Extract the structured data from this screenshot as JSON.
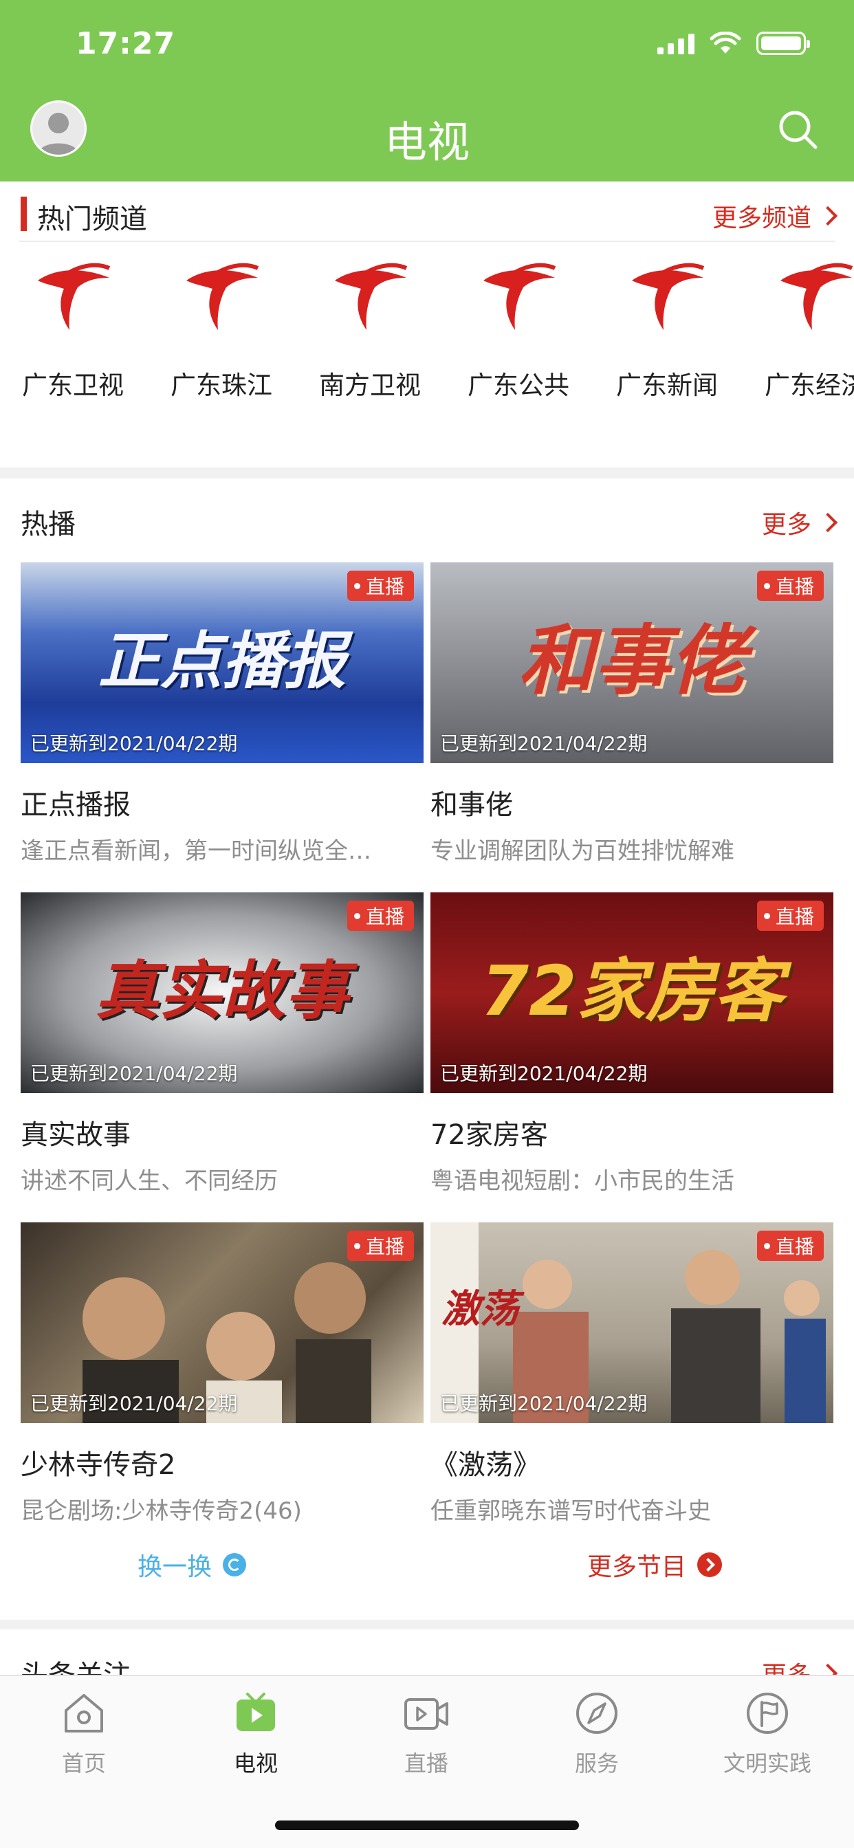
{
  "status_bar": {
    "time": "17:27"
  },
  "header": {
    "title": "电视"
  },
  "colors": {
    "brand_green": "#7ec953",
    "accent_red": "#d42d20",
    "live_red": "#e23b30",
    "refresh_blue": "#4ab1e6"
  },
  "hot_channels": {
    "title": "热门频道",
    "more_label": "更多频道",
    "items": [
      {
        "name": "广东卫视"
      },
      {
        "name": "广东珠江"
      },
      {
        "name": "南方卫视"
      },
      {
        "name": "广东公共"
      },
      {
        "name": "广东新闻"
      },
      {
        "name": "广东经济"
      }
    ]
  },
  "hot_shows": {
    "title": "热播",
    "more_label": "更多",
    "live_badge": "直播",
    "items": [
      {
        "title": "正点播报",
        "desc": "逢正点看新闻，第一时间纵览全…",
        "update": "已更新到2021/04/22期",
        "art_text": "正点播报"
      },
      {
        "title": "和事佬",
        "desc": "专业调解团队为百姓排忧解难",
        "update": "已更新到2021/04/22期",
        "art_text": "和事佬"
      },
      {
        "title": "真实故事",
        "desc": "讲述不同人生、不同经历",
        "update": "已更新到2021/04/22期",
        "art_text": "真实故事"
      },
      {
        "title": "72家房客",
        "desc": "粤语电视短剧：小市民的生活",
        "update": "已更新到2021/04/22期",
        "art_text": "72家房客"
      },
      {
        "title": "少林寺传奇2",
        "desc": "昆仑剧场:少林寺传奇2(46)",
        "update": "已更新到2021/04/22期",
        "art_text": ""
      },
      {
        "title": "《激荡》",
        "desc": "任重郭晓东谱写时代奋斗史",
        "update": "已更新到2021/04/22期",
        "art_text": "激荡"
      }
    ],
    "refresh_label": "换一换",
    "more_programs_label": "更多节目"
  },
  "headline": {
    "title": "头条关注",
    "more_label": "更多"
  },
  "tabbar": {
    "items": [
      {
        "label": "首页",
        "icon": "home-icon"
      },
      {
        "label": "电视",
        "icon": "tv-icon"
      },
      {
        "label": "直播",
        "icon": "live-video-icon"
      },
      {
        "label": "服务",
        "icon": "compass-icon"
      },
      {
        "label": "文明实践",
        "icon": "flag-circle-icon"
      }
    ]
  }
}
